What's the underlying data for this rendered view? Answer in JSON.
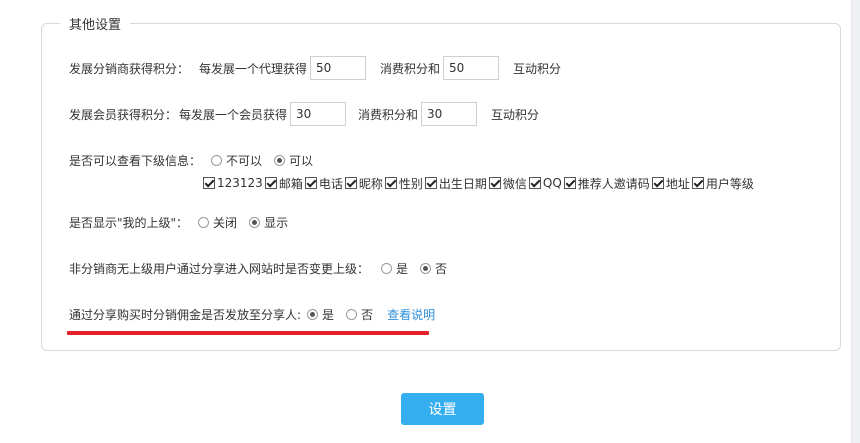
{
  "section": {
    "legend": "其他设置"
  },
  "distributor_points": {
    "label": "发展分销商获得积分：",
    "text1": "每发展一个代理获得",
    "value1": "50",
    "text2": "消费积分和",
    "value2": "50",
    "text3": "互动积分"
  },
  "member_points": {
    "label": "发展会员获得积分：",
    "text1": "每发展一个会员获得",
    "value1": "30",
    "text2": "消费积分和",
    "value2": "30",
    "text3": "互动积分"
  },
  "view_subordinate": {
    "label": "是否可以查看下级信息：",
    "options": [
      "不可以",
      "可以"
    ],
    "selected": "可以",
    "fields": [
      "123123",
      "邮箱",
      "电话",
      "昵称",
      "性别",
      "出生日期",
      "微信",
      "QQ",
      "推荐人邀请码",
      "地址",
      "用户等级"
    ]
  },
  "show_superior": {
    "label": "是否显示\"我的上级\"：",
    "options": [
      "关闭",
      "显示"
    ],
    "selected": "显示"
  },
  "change_superior": {
    "label": "非分销商无上级用户通过分享进入网站时是否变更上级：",
    "options": [
      "是",
      "否"
    ],
    "selected": "否"
  },
  "share_commission": {
    "label": "通过分享购买时分销佣金是否发放至分享人:",
    "options": [
      "是",
      "否"
    ],
    "selected": "是",
    "link": "查看说明"
  },
  "submit": {
    "label": "设置"
  }
}
